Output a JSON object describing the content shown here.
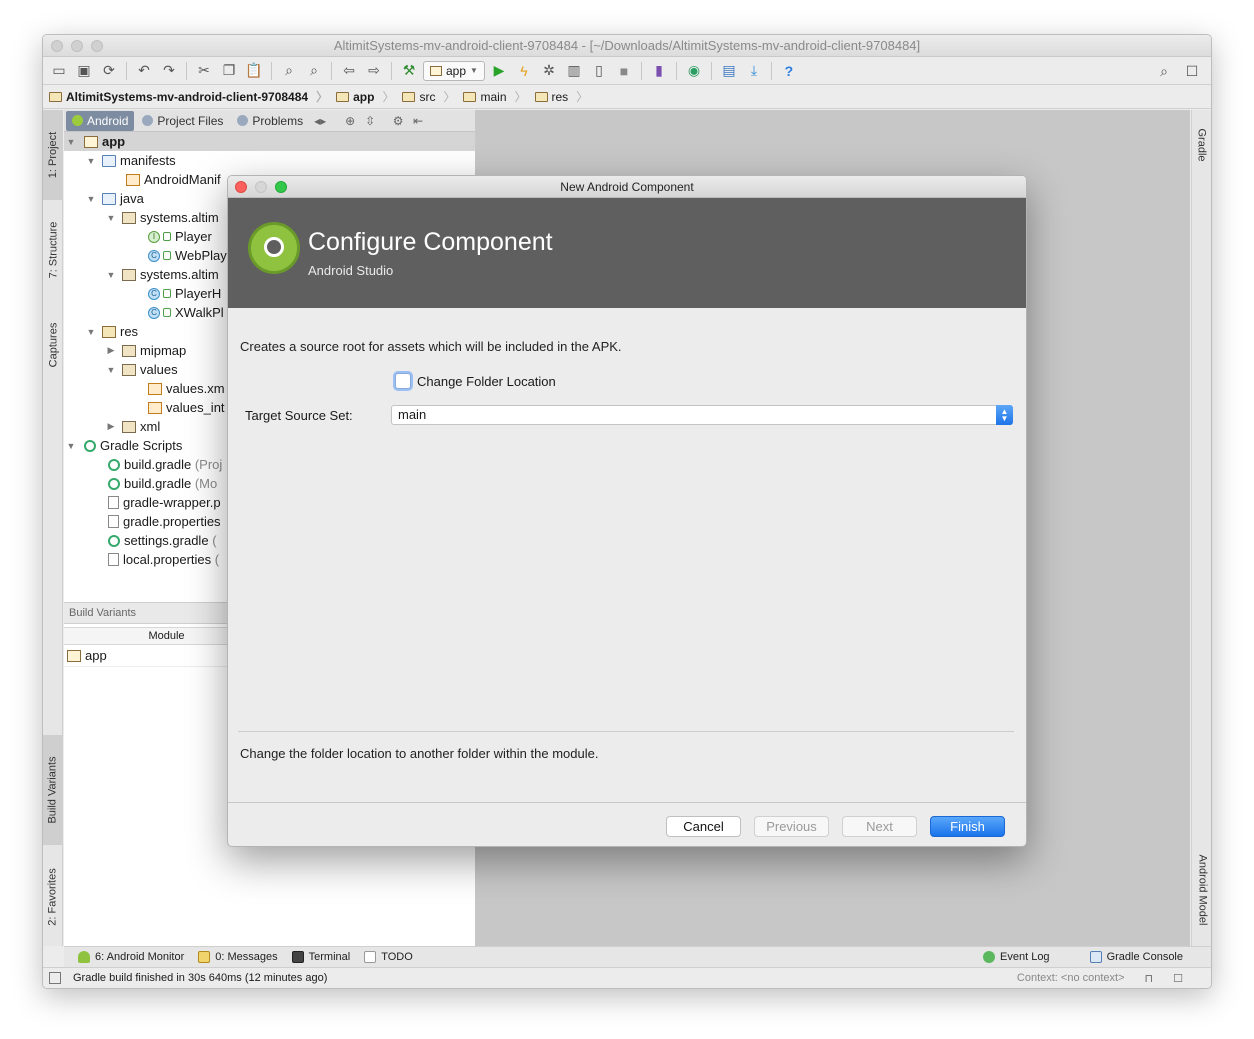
{
  "window": {
    "title": "AltimitSystems-mv-android-client-9708484 - [~/Downloads/AltimitSystems-mv-android-client-9708484]"
  },
  "toolbar": {
    "run_config": "app"
  },
  "breadcrumbs": [
    "AltimitSystems-mv-android-client-9708484",
    "app",
    "src",
    "main",
    "res"
  ],
  "left_tool_tabs": [
    "1: Project",
    "7: Structure",
    "Captures",
    "Build Variants",
    "2: Favorites"
  ],
  "right_tool_tabs": [
    "Gradle",
    "Android Model"
  ],
  "project_panel": {
    "tabs": [
      "Android",
      "Project Files",
      "Problems"
    ],
    "tree": [
      {
        "label": "app",
        "extra": ""
      },
      {
        "label": "manifests",
        "extra": ""
      },
      {
        "label": "AndroidManif",
        "extra": ""
      },
      {
        "label": "java",
        "extra": ""
      },
      {
        "label": "systems.altim",
        "extra": ""
      },
      {
        "label": "Player",
        "extra": ""
      },
      {
        "label": "WebPlay",
        "extra": ""
      },
      {
        "label": "systems.altim",
        "extra": ""
      },
      {
        "label": "PlayerH",
        "extra": ""
      },
      {
        "label": "XWalkPl",
        "extra": ""
      },
      {
        "label": "res",
        "extra": ""
      },
      {
        "label": "mipmap",
        "extra": ""
      },
      {
        "label": "values",
        "extra": ""
      },
      {
        "label": "values.xm",
        "extra": ""
      },
      {
        "label": "values_int",
        "extra": ""
      },
      {
        "label": "xml",
        "extra": ""
      },
      {
        "label": "Gradle Scripts",
        "extra": ""
      },
      {
        "label": "build.gradle",
        "extra": "(Proj"
      },
      {
        "label": "build.gradle",
        "extra": "(Mo"
      },
      {
        "label": "gradle-wrapper.p",
        "extra": ""
      },
      {
        "label": "gradle.properties",
        "extra": ""
      },
      {
        "label": "settings.gradle",
        "extra": "("
      },
      {
        "label": "local.properties",
        "extra": "("
      }
    ]
  },
  "build_variants": {
    "title": "Build Variants",
    "column_module": "Module",
    "rows": [
      "app"
    ]
  },
  "bottom_tabs": [
    "6: Android Monitor",
    "0: Messages",
    "Terminal",
    "TODO"
  ],
  "bottom_tabs_right": [
    "Event Log",
    "Gradle Console"
  ],
  "status": {
    "message": "Gradle build finished in 30s 640ms (12 minutes ago)",
    "context": "Context: <no context>"
  },
  "dialog": {
    "window_title": "New Android Component",
    "banner_title": "Configure Component",
    "banner_subtitle": "Android Studio",
    "description": "Creates a source root for assets which will be included in the APK.",
    "checkbox_label": "Change Folder Location",
    "checkbox_checked": false,
    "target_label": "Target Source Set:",
    "target_value": "main",
    "hint": "Change the folder location to another folder within the module.",
    "buttons": {
      "cancel": "Cancel",
      "previous": "Previous",
      "next": "Next",
      "finish": "Finish"
    }
  }
}
